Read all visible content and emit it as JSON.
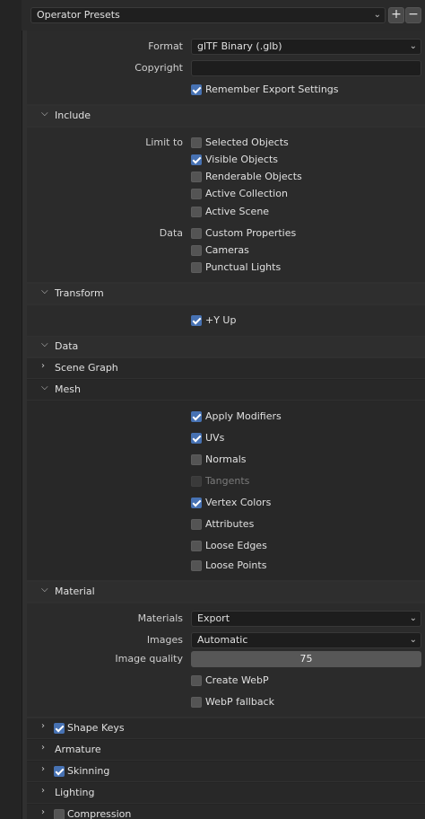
{
  "presets": {
    "label": "Operator Presets",
    "add": "+",
    "remove": "−"
  },
  "general": {
    "format_label": "Format",
    "format_value": "glTF Binary (.glb)",
    "copyright_label": "Copyright",
    "copyright_value": "",
    "remember_label": "Remember Export Settings"
  },
  "include": {
    "title": "Include",
    "limit_label": "Limit to",
    "limit_items": [
      "Selected Objects",
      "Visible Objects",
      "Renderable Objects",
      "Active Collection",
      "Active Scene"
    ],
    "data_label": "Data",
    "data_items": [
      "Custom Properties",
      "Cameras",
      "Punctual Lights"
    ]
  },
  "transform": {
    "title": "Transform",
    "yup_label": "+Y Up"
  },
  "data": {
    "title": "Data",
    "scene_graph": "Scene Graph",
    "mesh": "Mesh"
  },
  "mesh": {
    "items": [
      "Apply Modifiers",
      "UVs",
      "Normals",
      "Tangents",
      "Vertex Colors",
      "Attributes",
      "Loose Edges",
      "Loose Points"
    ]
  },
  "material": {
    "title": "Material",
    "materials_label": "Materials",
    "materials_value": "Export",
    "images_label": "Images",
    "images_value": "Automatic",
    "quality_label": "Image quality",
    "quality_value": "75",
    "webp_label": "Create WebP",
    "webp_fallback_label": "WebP fallback"
  },
  "bottom": {
    "shape_keys": "Shape Keys",
    "armature": "Armature",
    "skinning": "Skinning",
    "lighting": "Lighting",
    "compression": "Compression"
  },
  "colors": {
    "accent": "#4772b3",
    "bg": "#303030",
    "panel": "#2b2b2b"
  }
}
